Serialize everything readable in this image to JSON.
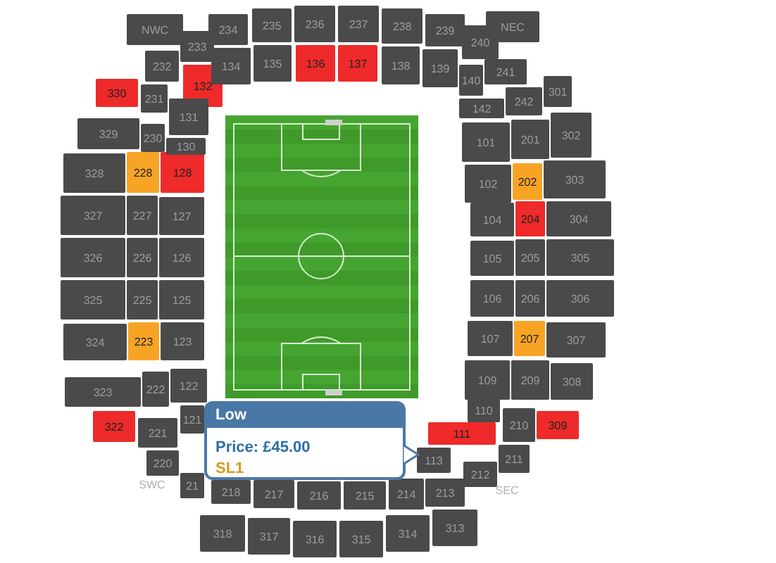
{
  "map": {
    "sections": [
      {
        "label": "NWC",
        "color": "#4a4a4a"
      },
      {
        "label": "233",
        "color": "#4a4a4a"
      },
      {
        "label": "232",
        "color": "#4a4a4a"
      },
      {
        "label": "132",
        "color": "#ee2a2a"
      },
      {
        "label": "330",
        "color": "#ee2a2a"
      },
      {
        "label": "231",
        "color": "#4a4a4a"
      },
      {
        "label": "131",
        "color": "#4a4a4a"
      },
      {
        "label": "234",
        "color": "#4a4a4a"
      },
      {
        "label": "134",
        "color": "#4a4a4a"
      },
      {
        "label": "235",
        "color": "#4a4a4a"
      },
      {
        "label": "135",
        "color": "#4a4a4a"
      },
      {
        "label": "236",
        "color": "#4a4a4a"
      },
      {
        "label": "136",
        "color": "#ee2a2a"
      },
      {
        "label": "237",
        "color": "#4a4a4a"
      },
      {
        "label": "137",
        "color": "#ee2a2a"
      },
      {
        "label": "238",
        "color": "#4a4a4a"
      },
      {
        "label": "138",
        "color": "#4a4a4a"
      },
      {
        "label": "239",
        "color": "#4a4a4a"
      },
      {
        "label": "139",
        "color": "#4a4a4a"
      },
      {
        "label": "NEC",
        "color": "#4a4a4a"
      },
      {
        "label": "240",
        "color": "#4a4a4a"
      },
      {
        "label": "241",
        "color": "#4a4a4a"
      },
      {
        "label": "140",
        "color": "#4a4a4a"
      },
      {
        "label": "142",
        "color": "#4a4a4a"
      },
      {
        "label": "242",
        "color": "#4a4a4a"
      },
      {
        "label": "301",
        "color": "#4a4a4a"
      },
      {
        "label": "101",
        "color": "#4a4a4a"
      },
      {
        "label": "201",
        "color": "#4a4a4a"
      },
      {
        "label": "302",
        "color": "#4a4a4a"
      },
      {
        "label": "102",
        "color": "#4a4a4a"
      },
      {
        "label": "202",
        "color": "#f7a425"
      },
      {
        "label": "303",
        "color": "#4a4a4a"
      },
      {
        "label": "104",
        "color": "#4a4a4a"
      },
      {
        "label": "204",
        "color": "#ee2a2a"
      },
      {
        "label": "304",
        "color": "#4a4a4a"
      },
      {
        "label": "105",
        "color": "#4a4a4a"
      },
      {
        "label": "205",
        "color": "#4a4a4a"
      },
      {
        "label": "305",
        "color": "#4a4a4a"
      },
      {
        "label": "106",
        "color": "#4a4a4a"
      },
      {
        "label": "206",
        "color": "#4a4a4a"
      },
      {
        "label": "306",
        "color": "#4a4a4a"
      },
      {
        "label": "107",
        "color": "#4a4a4a"
      },
      {
        "label": "207",
        "color": "#f7a425"
      },
      {
        "label": "307",
        "color": "#4a4a4a"
      },
      {
        "label": "109",
        "color": "#4a4a4a"
      },
      {
        "label": "209",
        "color": "#4a4a4a"
      },
      {
        "label": "308",
        "color": "#4a4a4a"
      },
      {
        "label": "110",
        "color": "#4a4a4a"
      },
      {
        "label": "210",
        "color": "#4a4a4a"
      },
      {
        "label": "309",
        "color": "#ee2a2a"
      },
      {
        "label": "111",
        "color": "#ee2a2a"
      },
      {
        "label": "211",
        "color": "#4a4a4a"
      },
      {
        "label": "212",
        "color": "#4a4a4a"
      },
      {
        "label": "113",
        "color": "#4a4a4a"
      },
      {
        "label": "21",
        "color": "#4a4a4a"
      },
      {
        "label": "218",
        "color": "#4a4a4a"
      },
      {
        "label": "217",
        "color": "#4a4a4a"
      },
      {
        "label": "216",
        "color": "#4a4a4a"
      },
      {
        "label": "215",
        "color": "#4a4a4a"
      },
      {
        "label": "214",
        "color": "#4a4a4a"
      },
      {
        "label": "213",
        "color": "#4a4a4a"
      },
      {
        "label": "121",
        "color": "#4a4a4a"
      },
      {
        "label": "221",
        "color": "#4a4a4a"
      },
      {
        "label": "220",
        "color": "#4a4a4a"
      },
      {
        "label": "322",
        "color": "#ee2a2a"
      },
      {
        "label": "323",
        "color": "#4a4a4a"
      },
      {
        "label": "222",
        "color": "#4a4a4a"
      },
      {
        "label": "122",
        "color": "#4a4a4a"
      },
      {
        "label": "324",
        "color": "#4a4a4a"
      },
      {
        "label": "223",
        "color": "#f7a425"
      },
      {
        "label": "123",
        "color": "#4a4a4a"
      },
      {
        "label": "325",
        "color": "#4a4a4a"
      },
      {
        "label": "225",
        "color": "#4a4a4a"
      },
      {
        "label": "125",
        "color": "#4a4a4a"
      },
      {
        "label": "326",
        "color": "#4a4a4a"
      },
      {
        "label": "226",
        "color": "#4a4a4a"
      },
      {
        "label": "126",
        "color": "#4a4a4a"
      },
      {
        "label": "327",
        "color": "#4a4a4a"
      },
      {
        "label": "227",
        "color": "#4a4a4a"
      },
      {
        "label": "127",
        "color": "#4a4a4a"
      },
      {
        "label": "328",
        "color": "#4a4a4a"
      },
      {
        "label": "228",
        "color": "#f7a425"
      },
      {
        "label": "128",
        "color": "#ee2a2a"
      },
      {
        "label": "329",
        "color": "#4a4a4a"
      },
      {
        "label": "230",
        "color": "#4a4a4a"
      },
      {
        "label": "130",
        "color": "#4a4a4a"
      },
      {
        "label": "318",
        "color": "#4a4a4a"
      },
      {
        "label": "317",
        "color": "#4a4a4a"
      },
      {
        "label": "316",
        "color": "#4a4a4a"
      },
      {
        "label": "315",
        "color": "#4a4a4a"
      },
      {
        "label": "314",
        "color": "#4a4a4a"
      },
      {
        "label": "313",
        "color": "#4a4a4a"
      }
    ],
    "area_labels": [
      "SWC",
      "SEC"
    ]
  },
  "tooltip": {
    "title": "Low",
    "price": "Price: £45.00",
    "code": "SL1"
  }
}
